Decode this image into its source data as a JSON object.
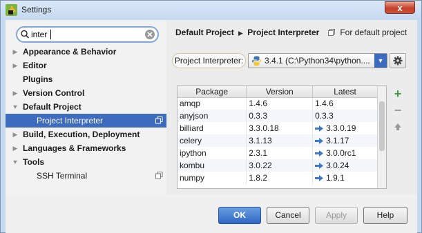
{
  "window": {
    "title": "Settings",
    "close_label": "x"
  },
  "search": {
    "value": "inter"
  },
  "tree": [
    {
      "label": "Appearance & Behavior",
      "arrow": "▶",
      "child": false,
      "selected": false
    },
    {
      "label": "Editor",
      "arrow": "▶",
      "child": false,
      "selected": false
    },
    {
      "label": "Plugins",
      "arrow": "",
      "child": false,
      "selected": false
    },
    {
      "label": "Version Control",
      "arrow": "▶",
      "child": false,
      "selected": false
    },
    {
      "label": "Default Project",
      "arrow": "▼",
      "child": false,
      "selected": false
    },
    {
      "label": "Project Interpreter",
      "arrow": "",
      "child": true,
      "selected": true
    },
    {
      "label": "Build, Execution, Deployment",
      "arrow": "▶",
      "child": false,
      "selected": false
    },
    {
      "label": "Languages & Frameworks",
      "arrow": "▶",
      "child": false,
      "selected": false
    },
    {
      "label": "Tools",
      "arrow": "▼",
      "child": false,
      "selected": false
    },
    {
      "label": "SSH Terminal",
      "arrow": "",
      "child": true,
      "selected": false
    }
  ],
  "breadcrumb": {
    "parent": "Default Project",
    "current": "Project Interpreter",
    "scope": "For default project"
  },
  "interpreter": {
    "label": "Project Interpreter:",
    "value": "3.4.1 (C:\\Python34\\python...."
  },
  "packages": {
    "columns": [
      "Package",
      "Version",
      "Latest"
    ],
    "rows": [
      {
        "name": "amqp",
        "version": "1.4.6",
        "latest": "1.4.6",
        "upgrade": false
      },
      {
        "name": "anyjson",
        "version": "0.3.3",
        "latest": "0.3.3",
        "upgrade": false
      },
      {
        "name": "billiard",
        "version": "3.3.0.18",
        "latest": "3.3.0.19",
        "upgrade": true
      },
      {
        "name": "celery",
        "version": "3.1.13",
        "latest": "3.1.17",
        "upgrade": true
      },
      {
        "name": "ipython",
        "version": "2.3.1",
        "latest": "3.0.0rc1",
        "upgrade": true
      },
      {
        "name": "kombu",
        "version": "3.0.22",
        "latest": "3.0.24",
        "upgrade": true
      },
      {
        "name": "numpy",
        "version": "1.8.2",
        "latest": "1.9.1",
        "upgrade": true
      }
    ]
  },
  "buttons": {
    "ok": "OK",
    "cancel": "Cancel",
    "apply": "Apply",
    "help": "Help"
  },
  "colors": {
    "selection": "#3d6bbd",
    "upgrade_arrow": "#3d78c8",
    "add_green": "#3b9a3b"
  }
}
